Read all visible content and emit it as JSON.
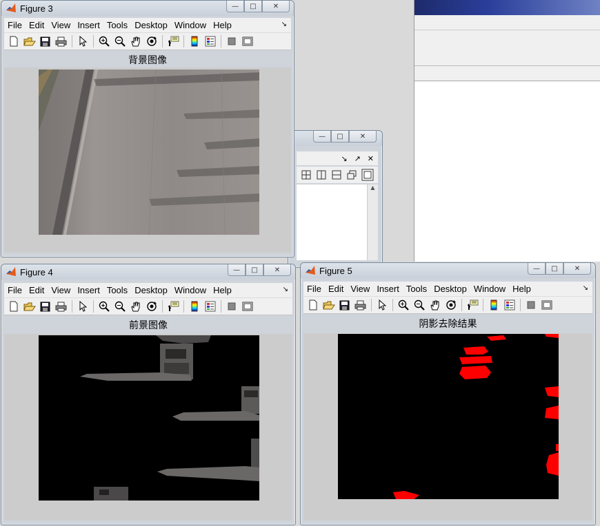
{
  "figures": {
    "fig3": {
      "title": "Figure 3",
      "axes_title": "背景图像",
      "image": "background-road-image"
    },
    "fig4": {
      "title": "Figure 4",
      "axes_title": "前景图像",
      "image": "foreground-vehicles-image"
    },
    "fig5": {
      "title": "Figure 5",
      "axes_title": "阴影去除结果",
      "image": "shadow-removal-result-image"
    }
  },
  "menu": [
    "File",
    "Edit",
    "View",
    "Insert",
    "Tools",
    "Desktop",
    "Window",
    "Help"
  ],
  "toolbar_icons": [
    "new-figure-icon",
    "open-file-icon",
    "save-icon",
    "print-icon",
    "pointer-icon",
    "zoom-in-icon",
    "zoom-out-icon",
    "pan-hand-icon",
    "rotate-3d-icon",
    "data-cursor-icon",
    "colorbar-icon",
    "legend-icon",
    "hide-plot-tools-icon",
    "show-plot-tools-icon"
  ],
  "colors": {
    "window_frame": "#cfd4db",
    "figure_background": "#cccccc",
    "image_black": "#000000",
    "shadow_red": "#ff0000",
    "road_gray": "#8f8b88"
  }
}
